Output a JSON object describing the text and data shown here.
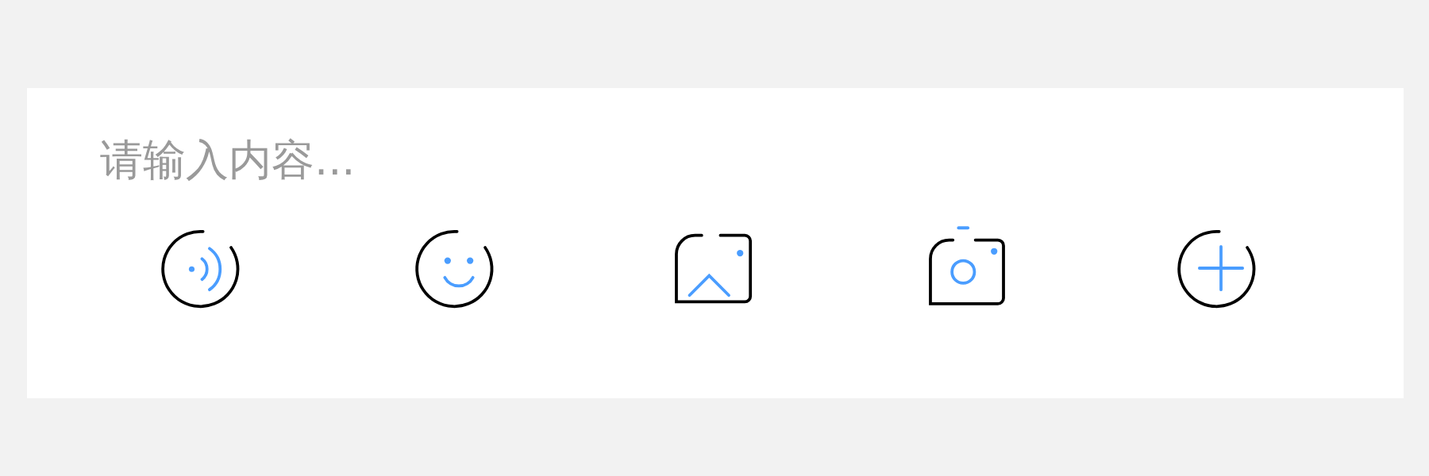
{
  "input": {
    "placeholder": "请输入内容..."
  },
  "toolbar": [
    {
      "kind": "voice"
    },
    {
      "kind": "emoji"
    },
    {
      "kind": "image"
    },
    {
      "kind": "camera"
    },
    {
      "kind": "plus"
    }
  ]
}
